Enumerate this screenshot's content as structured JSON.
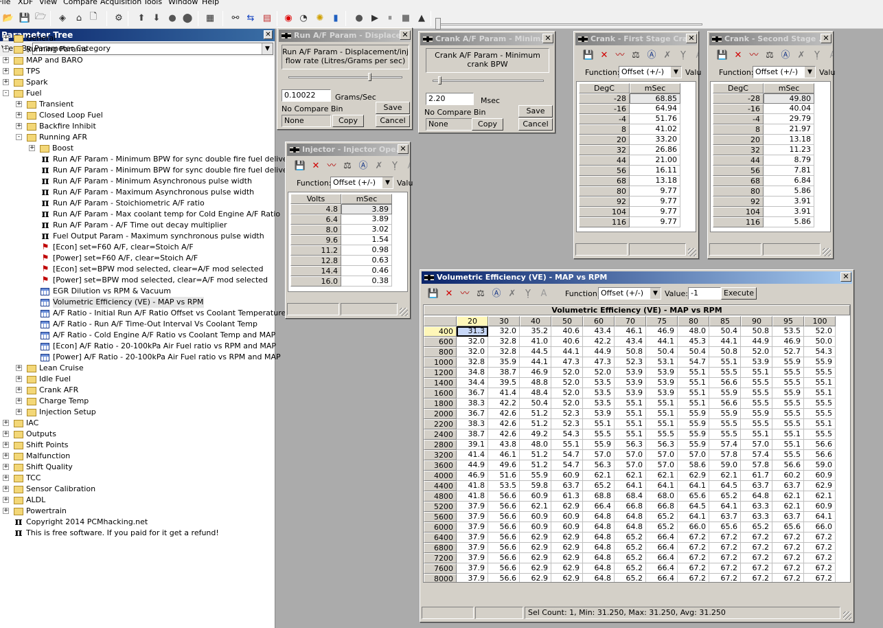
{
  "menu": [
    "File",
    "XDF",
    "View",
    "Compare",
    "Acquisition",
    "Tools",
    "Window",
    "Help"
  ],
  "tree": {
    "title": "Parameter Tree",
    "view_by_label": "View By:",
    "view_by_value": "Parameter Category",
    "nodes": [
      {
        "label": "General",
        "icon": "folder",
        "indent": 0,
        "exp": "+"
      },
      {
        "label": "Running Params",
        "icon": "folder",
        "indent": 0,
        "exp": "+"
      },
      {
        "label": "MAP and BARO",
        "icon": "folder",
        "indent": 0,
        "exp": "+"
      },
      {
        "label": "TPS",
        "icon": "folder",
        "indent": 0,
        "exp": "+"
      },
      {
        "label": "Spark",
        "icon": "folder",
        "indent": 0,
        "exp": "+"
      },
      {
        "label": "Fuel",
        "icon": "folder",
        "indent": 0,
        "exp": "-"
      },
      {
        "label": "Transient",
        "icon": "folder",
        "indent": 1,
        "exp": "+"
      },
      {
        "label": "Closed Loop Fuel",
        "icon": "folder",
        "indent": 1,
        "exp": "+"
      },
      {
        "label": "Backfire Inhibit",
        "icon": "folder",
        "indent": 1,
        "exp": "+"
      },
      {
        "label": "Running AFR",
        "icon": "folder",
        "indent": 1,
        "exp": "-"
      },
      {
        "label": "Boost",
        "icon": "folder",
        "indent": 2,
        "exp": "+"
      },
      {
        "label": "Run A/F Param - Minimum BPW for sync double fire fuel delivery (Up",
        "icon": "pi",
        "indent": 2
      },
      {
        "label": "Run A/F Param - Minimum BPW for sync double fire fuel delivery (Lc",
        "icon": "pi",
        "indent": 2
      },
      {
        "label": "Run A/F Param - Minimum Asynchronous pulse width",
        "icon": "pi",
        "indent": 2
      },
      {
        "label": "Run A/F Param - Maximum Asynchronous pulse width",
        "icon": "pi",
        "indent": 2
      },
      {
        "label": "Run A/F Param - Stoichiometric A/F ratio",
        "icon": "pi",
        "indent": 2
      },
      {
        "label": "Run A/F Param - Max coolant temp for Cold Engine A/F Ratio",
        "icon": "pi",
        "indent": 2
      },
      {
        "label": "Run A/F Param - A/F Time out decay multiplier",
        "icon": "pi",
        "indent": 2
      },
      {
        "label": "Fuel Output Param - Maximum synchronous pulse width",
        "icon": "pi",
        "indent": 2
      },
      {
        "label": "[Econ] set=F60 A/F, clear=Stoich A/F",
        "icon": "flag",
        "indent": 2
      },
      {
        "label": "[Power] set=F60 A/F, clear=Stoich A/F",
        "icon": "flag",
        "indent": 2
      },
      {
        "label": "[Econ] set=BPW mod selected, clear=A/F mod selected",
        "icon": "flag",
        "indent": 2
      },
      {
        "label": "[Power] set=BPW mod selected, clear=A/F mod selected",
        "icon": "flag",
        "indent": 2
      },
      {
        "label": "EGR Dilution vs RPM & Vacuum",
        "icon": "table",
        "indent": 2
      },
      {
        "label": "Volumetric Efficiency (VE) - MAP vs RPM",
        "icon": "table",
        "indent": 2,
        "selected": true
      },
      {
        "label": "A/F Ratio - Initial Run A/F Ratio Offset vs Coolant Temperature",
        "icon": "table",
        "indent": 2
      },
      {
        "label": "A/F Ratio - Run A/F Time-Out Interval Vs Coolant Temp",
        "icon": "table",
        "indent": 2
      },
      {
        "label": "A/F Ratio - Cold Engine A/F Ratio vs Coolant Temp and MAP",
        "icon": "table",
        "indent": 2
      },
      {
        "label": "[Econ] A/F Ratio - 20-100kPa Air Fuel ratio vs RPM and MAP",
        "icon": "table",
        "indent": 2
      },
      {
        "label": "[Power] A/F Ratio - 20-100kPa Air Fuel ratio vs RPM and MAP",
        "icon": "table",
        "indent": 2
      },
      {
        "label": "Lean Cruise",
        "icon": "folder",
        "indent": 1,
        "exp": "+"
      },
      {
        "label": "Idle Fuel",
        "icon": "folder",
        "indent": 1,
        "exp": "+"
      },
      {
        "label": "Crank AFR",
        "icon": "folder",
        "indent": 1,
        "exp": "+"
      },
      {
        "label": "Charge Temp",
        "icon": "folder",
        "indent": 1,
        "exp": "+"
      },
      {
        "label": "Injection Setup",
        "icon": "folder",
        "indent": 1,
        "exp": "+"
      },
      {
        "label": "IAC",
        "icon": "folder",
        "indent": 0,
        "exp": "+"
      },
      {
        "label": "Outputs",
        "icon": "folder",
        "indent": 0,
        "exp": "+"
      },
      {
        "label": "Shift Points",
        "icon": "folder",
        "indent": 0,
        "exp": "+"
      },
      {
        "label": "Malfunction",
        "icon": "folder",
        "indent": 0,
        "exp": "+"
      },
      {
        "label": "Shift Quality",
        "icon": "folder",
        "indent": 0,
        "exp": "+"
      },
      {
        "label": "TCC",
        "icon": "folder",
        "indent": 0,
        "exp": "+"
      },
      {
        "label": "Sensor Calibration",
        "icon": "folder",
        "indent": 0,
        "exp": "+"
      },
      {
        "label": "ALDL",
        "icon": "folder",
        "indent": 0,
        "exp": "+"
      },
      {
        "label": "Powertrain",
        "icon": "folder",
        "indent": 0,
        "exp": "+"
      },
      {
        "label": "Copyright 2014 PCMhacking.net",
        "icon": "pi",
        "indent": 0,
        "leaf": true
      },
      {
        "label": "This is free software. If you paid for it get a refund!",
        "icon": "pi",
        "indent": 0,
        "leaf": true
      }
    ]
  },
  "runaf": {
    "title": "Run A/F Param - Displace...",
    "desc": "Run A/F Param - Displacement/inj flow rate (Litres/Grams per sec)",
    "value": "0.10022",
    "unit": "Grams/Sec",
    "save": "Save",
    "compare_label": "No Compare Bin",
    "compare_value": "None",
    "copy": "Copy",
    "cancel": "Cancel",
    "slider": 0.7
  },
  "crankaf": {
    "title": "Crank A/F Param - Minim...",
    "desc": "Crank A/F Param - Minimum crank BPW",
    "value": "2.20",
    "unit": "Msec",
    "save": "Save",
    "compare_label": "No Compare Bin",
    "compare_value": "None",
    "copy": "Copy",
    "cancel": "Cancel",
    "slider": 0.05
  },
  "injector": {
    "title": "Injector - Injector Ope...",
    "function_label": "Function:",
    "function_value": "Offset (+/-)",
    "value_label": "Valu",
    "col_headers": [
      "Volts",
      "mSec"
    ],
    "rows": [
      [
        "4.8",
        "3.89"
      ],
      [
        "6.4",
        "3.89"
      ],
      [
        "8.0",
        "3.02"
      ],
      [
        "9.6",
        "1.54"
      ],
      [
        "11.2",
        "0.98"
      ],
      [
        "12.8",
        "0.63"
      ],
      [
        "14.4",
        "0.46"
      ],
      [
        "16.0",
        "0.38"
      ]
    ]
  },
  "crank1": {
    "title": "Crank - First Stage Cra...",
    "function_label": "Function:",
    "function_value": "Offset (+/-)",
    "value_label": "Valu",
    "col_headers": [
      "DegC",
      "mSec"
    ],
    "rows": [
      [
        "-28",
        "68.85"
      ],
      [
        "-16",
        "64.94"
      ],
      [
        "-4",
        "51.76"
      ],
      [
        "8",
        "41.02"
      ],
      [
        "20",
        "33.20"
      ],
      [
        "32",
        "26.86"
      ],
      [
        "44",
        "21.00"
      ],
      [
        "56",
        "16.11"
      ],
      [
        "68",
        "13.18"
      ],
      [
        "80",
        "9.77"
      ],
      [
        "92",
        "9.77"
      ],
      [
        "104",
        "9.77"
      ],
      [
        "116",
        "9.77"
      ]
    ]
  },
  "crank2": {
    "title": "Crank - Second Stage ...",
    "function_label": "Function:",
    "function_value": "Offset (+/-)",
    "value_label": "Valu",
    "col_headers": [
      "DegC",
      "mSec"
    ],
    "rows": [
      [
        "-28",
        "49.80"
      ],
      [
        "-16",
        "40.04"
      ],
      [
        "-4",
        "29.79"
      ],
      [
        "8",
        "21.97"
      ],
      [
        "20",
        "13.18"
      ],
      [
        "32",
        "11.23"
      ],
      [
        "44",
        "8.79"
      ],
      [
        "56",
        "7.81"
      ],
      [
        "68",
        "6.84"
      ],
      [
        "80",
        "5.86"
      ],
      [
        "92",
        "3.91"
      ],
      [
        "104",
        "3.91"
      ],
      [
        "116",
        "5.86"
      ]
    ]
  },
  "ve": {
    "title": "Volumetric Efficiency (VE) - MAP vs RPM",
    "function_label": "Function:",
    "function_value": "Offset (+/-)",
    "value_label": "Value:",
    "value": "-1",
    "execute": "Execute",
    "table_title": "Volumetric Efficiency (VE) - MAP vs RPM",
    "cols": [
      "20",
      "30",
      "40",
      "50",
      "60",
      "70",
      "75",
      "80",
      "85",
      "90",
      "95",
      "100"
    ],
    "rows": [
      {
        "rpm": "400",
        "v": [
          "31.3",
          "32.0",
          "35.2",
          "40.6",
          "43.4",
          "46.1",
          "46.9",
          "48.0",
          "50.4",
          "50.8",
          "53.5",
          "52.0"
        ]
      },
      {
        "rpm": "600",
        "v": [
          "32.0",
          "32.8",
          "41.0",
          "40.6",
          "42.2",
          "43.4",
          "44.1",
          "45.3",
          "44.1",
          "44.9",
          "46.9",
          "50.0"
        ]
      },
      {
        "rpm": "800",
        "v": [
          "32.0",
          "32.8",
          "44.5",
          "44.1",
          "44.9",
          "50.8",
          "50.4",
          "50.4",
          "50.8",
          "52.0",
          "52.7",
          "54.3"
        ]
      },
      {
        "rpm": "1000",
        "v": [
          "32.8",
          "35.9",
          "44.1",
          "47.3",
          "47.3",
          "52.3",
          "53.1",
          "54.7",
          "55.1",
          "53.9",
          "55.9",
          "55.9"
        ]
      },
      {
        "rpm": "1200",
        "v": [
          "34.8",
          "38.7",
          "46.9",
          "52.0",
          "52.0",
          "53.9",
          "53.9",
          "55.1",
          "55.5",
          "55.1",
          "55.5",
          "55.5"
        ]
      },
      {
        "rpm": "1400",
        "v": [
          "34.4",
          "39.5",
          "48.8",
          "52.0",
          "53.5",
          "53.9",
          "53.9",
          "55.1",
          "56.6",
          "55.5",
          "55.5",
          "55.1"
        ]
      },
      {
        "rpm": "1600",
        "v": [
          "36.7",
          "41.4",
          "48.4",
          "52.0",
          "53.5",
          "53.9",
          "53.9",
          "55.1",
          "55.9",
          "55.5",
          "55.9",
          "55.1"
        ]
      },
      {
        "rpm": "1800",
        "v": [
          "38.3",
          "42.2",
          "50.4",
          "52.0",
          "53.5",
          "55.1",
          "55.1",
          "55.1",
          "56.6",
          "55.5",
          "55.5",
          "55.5"
        ]
      },
      {
        "rpm": "2000",
        "v": [
          "36.7",
          "42.6",
          "51.2",
          "52.3",
          "53.9",
          "55.1",
          "55.1",
          "55.9",
          "55.9",
          "55.9",
          "55.5",
          "55.5"
        ]
      },
      {
        "rpm": "2200",
        "v": [
          "38.3",
          "42.6",
          "51.2",
          "52.3",
          "55.1",
          "55.1",
          "55.1",
          "55.9",
          "55.5",
          "55.5",
          "55.5",
          "55.1"
        ]
      },
      {
        "rpm": "2400",
        "v": [
          "38.7",
          "42.6",
          "49.2",
          "54.3",
          "55.5",
          "55.1",
          "55.5",
          "55.9",
          "55.5",
          "55.1",
          "55.1",
          "55.5"
        ]
      },
      {
        "rpm": "2800",
        "v": [
          "39.1",
          "43.8",
          "48.0",
          "55.1",
          "55.9",
          "56.3",
          "56.3",
          "55.9",
          "57.4",
          "57.0",
          "55.1",
          "56.6"
        ]
      },
      {
        "rpm": "3200",
        "v": [
          "41.4",
          "46.1",
          "51.2",
          "54.7",
          "57.0",
          "57.0",
          "57.0",
          "57.0",
          "57.8",
          "57.4",
          "55.5",
          "56.6"
        ]
      },
      {
        "rpm": "3600",
        "v": [
          "44.9",
          "49.6",
          "51.2",
          "54.7",
          "56.3",
          "57.0",
          "57.0",
          "58.6",
          "59.0",
          "57.8",
          "56.6",
          "59.0"
        ]
      },
      {
        "rpm": "4000",
        "v": [
          "46.9",
          "51.6",
          "55.9",
          "60.9",
          "62.1",
          "62.1",
          "62.1",
          "62.9",
          "62.1",
          "61.7",
          "60.2",
          "60.9"
        ]
      },
      {
        "rpm": "4400",
        "v": [
          "41.8",
          "53.5",
          "59.8",
          "63.7",
          "65.2",
          "64.1",
          "64.1",
          "64.1",
          "64.5",
          "63.7",
          "63.7",
          "62.9"
        ]
      },
      {
        "rpm": "4800",
        "v": [
          "41.8",
          "56.6",
          "60.9",
          "61.3",
          "68.8",
          "68.4",
          "68.0",
          "65.6",
          "65.2",
          "64.8",
          "62.1",
          "62.1"
        ]
      },
      {
        "rpm": "5200",
        "v": [
          "37.9",
          "56.6",
          "62.1",
          "62.9",
          "66.4",
          "66.8",
          "66.8",
          "64.5",
          "64.1",
          "63.3",
          "62.1",
          "60.9"
        ]
      },
      {
        "rpm": "5600",
        "v": [
          "37.9",
          "56.6",
          "60.9",
          "60.9",
          "64.8",
          "64.8",
          "65.2",
          "64.1",
          "63.7",
          "63.3",
          "63.7",
          "64.1"
        ]
      },
      {
        "rpm": "6000",
        "v": [
          "37.9",
          "56.6",
          "60.9",
          "60.9",
          "64.8",
          "64.8",
          "65.2",
          "66.0",
          "65.6",
          "65.2",
          "65.6",
          "66.0"
        ]
      },
      {
        "rpm": "6400",
        "v": [
          "37.9",
          "56.6",
          "62.9",
          "62.9",
          "64.8",
          "65.2",
          "66.4",
          "67.2",
          "67.2",
          "67.2",
          "67.2",
          "67.2"
        ]
      },
      {
        "rpm": "6800",
        "v": [
          "37.9",
          "56.6",
          "62.9",
          "62.9",
          "64.8",
          "65.2",
          "66.4",
          "67.2",
          "67.2",
          "67.2",
          "67.2",
          "67.2"
        ]
      },
      {
        "rpm": "7200",
        "v": [
          "37.9",
          "56.6",
          "62.9",
          "62.9",
          "64.8",
          "65.2",
          "66.4",
          "67.2",
          "67.2",
          "67.2",
          "67.2",
          "67.2"
        ]
      },
      {
        "rpm": "7600",
        "v": [
          "37.9",
          "56.6",
          "62.9",
          "62.9",
          "64.8",
          "65.2",
          "66.4",
          "67.2",
          "67.2",
          "67.2",
          "67.2",
          "67.2"
        ]
      },
      {
        "rpm": "8000",
        "v": [
          "37.9",
          "56.6",
          "62.9",
          "62.9",
          "64.8",
          "65.2",
          "66.4",
          "67.2",
          "67.2",
          "67.2",
          "67.2",
          "67.2"
        ]
      }
    ],
    "status": "Sel Count: 1, Min: 31.250, Max: 31.250, Avg: 31.250"
  },
  "toolbar_icons": [
    "open-folder-icon",
    "save-icon",
    "open-xdf-icon",
    "compare-icon",
    "home-icon",
    "blank-doc-icon",
    "wizard-icon",
    "arrow-up-icon",
    "arrow-down-icon",
    "record-icon",
    "stop-icon",
    "chip-icon",
    "connect-icon",
    "swap-icon",
    "grid-icon",
    "burn-icon",
    "gauge-icon",
    "light-icon",
    "bar-chart-icon",
    "dot-icon",
    "play-icon",
    "pause-icon",
    "stop-square-icon",
    "eject-icon"
  ],
  "colors": {
    "title_active": "#0a246a",
    "title_inactive": "#808080",
    "tree_title": "#0a246a",
    "selected_cell": "#fff7b8",
    "window_face": "#d4d0c8"
  }
}
